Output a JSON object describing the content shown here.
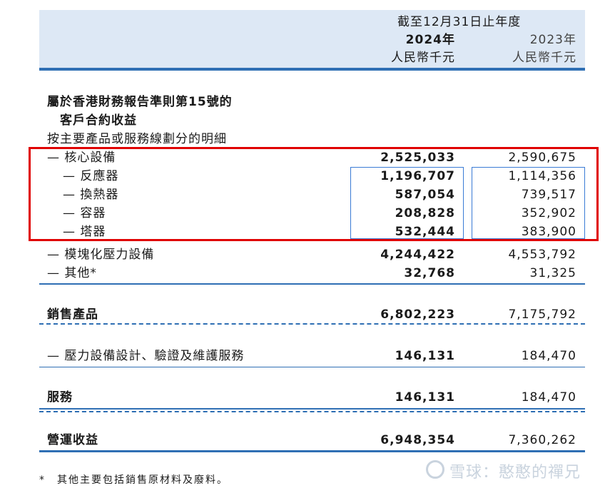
{
  "header": {
    "period": "截至12月31日止年度",
    "col_2024_year": "2024年",
    "col_2023_year": "2023年",
    "col_2024_unit": "人民幣千元",
    "col_2023_unit": "人民幣千元"
  },
  "section": {
    "title_line1": "屬於香港財務報告準則第15號的",
    "title_line2": "客戶合約收益",
    "subtitle": "按主要產品或服務線劃分的明細"
  },
  "rows": [
    {
      "label": "— 核心設備",
      "v2024": "2,525,033",
      "v2023": "2,590,675"
    },
    {
      "label": "— 反應器",
      "v2024": "1,196,707",
      "v2023": "1,114,356"
    },
    {
      "label": "— 換熱器",
      "v2024": "587,054",
      "v2023": "739,517"
    },
    {
      "label": "— 容器",
      "v2024": "208,828",
      "v2023": "352,902"
    },
    {
      "label": "— 塔器",
      "v2024": "532,444",
      "v2023": "383,900"
    },
    {
      "label": "— 模塊化壓力設備",
      "v2024": "4,244,422",
      "v2023": "4,553,792"
    },
    {
      "label": "— 其他*",
      "v2024": "32,768",
      "v2023": "31,325"
    }
  ],
  "subtotal_products": {
    "label": "銷售產品",
    "v2024": "6,802,223",
    "v2023": "7,175,792"
  },
  "service_row": {
    "label": "— 壓力設備設計、驗證及維護服務",
    "v2024": "146,131",
    "v2023": "184,470"
  },
  "subtotal_services": {
    "label": "服務",
    "v2024": "146,131",
    "v2023": "184,470"
  },
  "total": {
    "label": "營運收益",
    "v2024": "6,948,354",
    "v2023": "7,360,262"
  },
  "footnote": "*　其他主要包括銷售原材料及廢料。",
  "watermark": "雪球：憨憨的禪兄",
  "colors": {
    "accent_blue": "#2f6fb4",
    "header_bg": "#dde8f5",
    "highlight_red": "#e00000"
  }
}
